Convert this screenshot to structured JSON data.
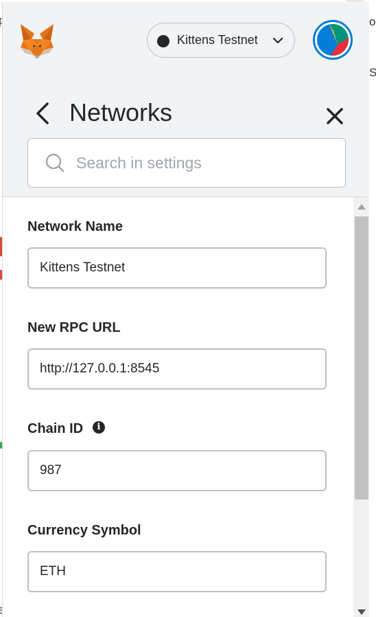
{
  "header": {
    "network_selector": {
      "label": "Kittens Testnet",
      "dot_color": "#24272a"
    },
    "account_avatar_colors": [
      "#037dd6",
      "#e8303c",
      "#00947a",
      "#f2c12e"
    ]
  },
  "settings": {
    "title": "Networks",
    "search": {
      "placeholder": "Search in settings",
      "value": ""
    }
  },
  "form": {
    "network_name": {
      "label": "Network Name",
      "value": "Kittens Testnet"
    },
    "rpc_url": {
      "label": "New RPC URL",
      "value": "http://127.0.0.1:8545"
    },
    "chain_id": {
      "label": "Chain ID",
      "value": "987",
      "info_icon": "i"
    },
    "currency_symbol": {
      "label": "Currency Symbol",
      "value": "ETH"
    }
  },
  "background_page": {
    "frag_top_left": "p",
    "frag_top_right": "o",
    "frag_right": "Sr",
    "frag_bottom_left": "e"
  }
}
